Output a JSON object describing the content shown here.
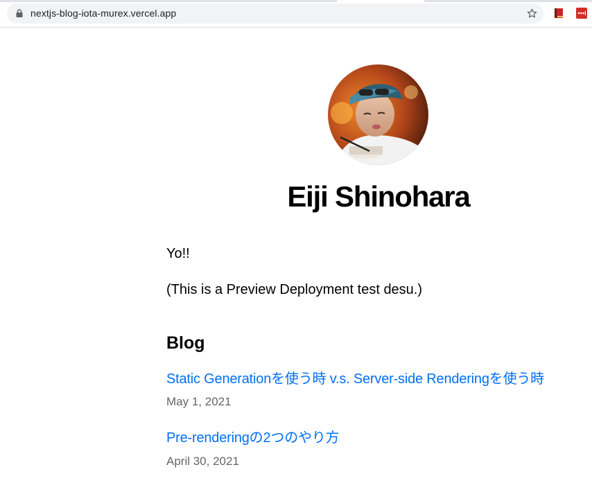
{
  "browser": {
    "url": "nextjs-blog-iota-murex.vercel.app",
    "extensions": [
      "book-extension-icon",
      "lastpass-icon"
    ]
  },
  "profile": {
    "name": "Eiji Shinohara",
    "avatar_icon": "profile-photo"
  },
  "intro": {
    "line1": "Yo!!",
    "line2": "(This is a Preview Deployment test desu.)"
  },
  "blog": {
    "heading": "Blog",
    "posts": [
      {
        "title": "Static Generationを使う時 v.s. Server-side Renderingを使う時",
        "date": "May 1, 2021"
      },
      {
        "title": "Pre-renderingの2つのやり方",
        "date": "April 30, 2021"
      }
    ]
  },
  "colors": {
    "link": "#0070f3",
    "date": "#666666",
    "omnibox": "#f1f3f4"
  }
}
